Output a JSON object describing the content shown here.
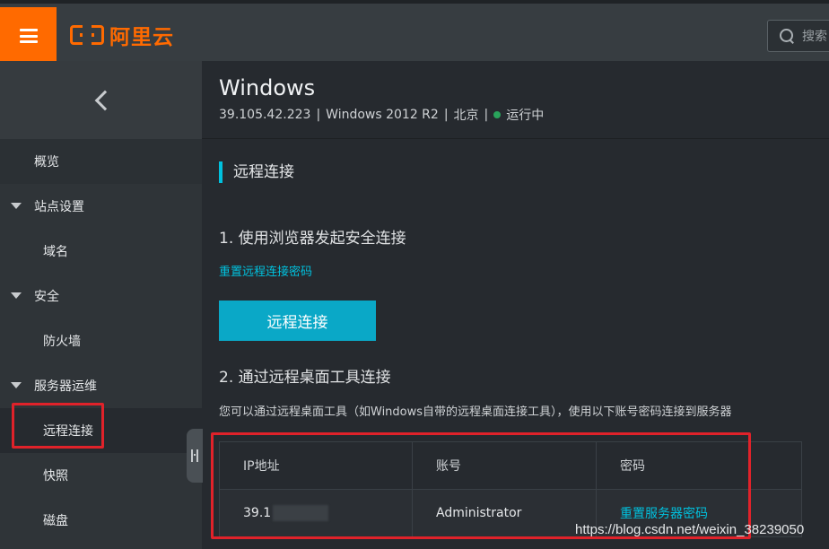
{
  "topbar": {
    "brand": "阿里云",
    "search_placeholder": "搜索"
  },
  "sidebar": {
    "items": [
      {
        "label": "概览",
        "level": "top"
      },
      {
        "label": "站点设置",
        "level": "group"
      },
      {
        "label": "域名",
        "level": "child"
      },
      {
        "label": "安全",
        "level": "group"
      },
      {
        "label": "防火墙",
        "level": "child"
      },
      {
        "label": "服务器运维",
        "level": "group"
      },
      {
        "label": "远程连接",
        "level": "child",
        "active": true
      },
      {
        "label": "快照",
        "level": "child"
      },
      {
        "label": "磁盘",
        "level": "child"
      }
    ]
  },
  "header": {
    "title": "Windows",
    "ip": "39.105.42.223",
    "os": "Windows 2012 R2",
    "region": "北京",
    "status": "运行中",
    "separator": "|"
  },
  "main": {
    "section_title": "远程连接",
    "step1_title": "1. 使用浏览器发起安全连接",
    "reset_remote_password_link": "重置远程连接密码",
    "connect_button": "远程连接",
    "step2_title": "2. 通过远程桌面工具连接",
    "description": "您可以通过远程桌面工具（如Windows自带的远程桌面连接工具），使用以下账号密码连接到服务器",
    "table": {
      "headers": [
        "IP地址",
        "账号",
        "密码"
      ],
      "row": {
        "ip_visible": "39.1",
        "account": "Administrator",
        "password_link": "重置服务器密码"
      }
    }
  },
  "watermark": "https://blog.csdn.net/weixin_38239050",
  "colors": {
    "brand_orange": "#ff6a00",
    "accent_cyan": "#00c1de",
    "button_blue": "#0aa8c7",
    "status_green": "#29a35b",
    "annotation_red": "#e0222a"
  }
}
